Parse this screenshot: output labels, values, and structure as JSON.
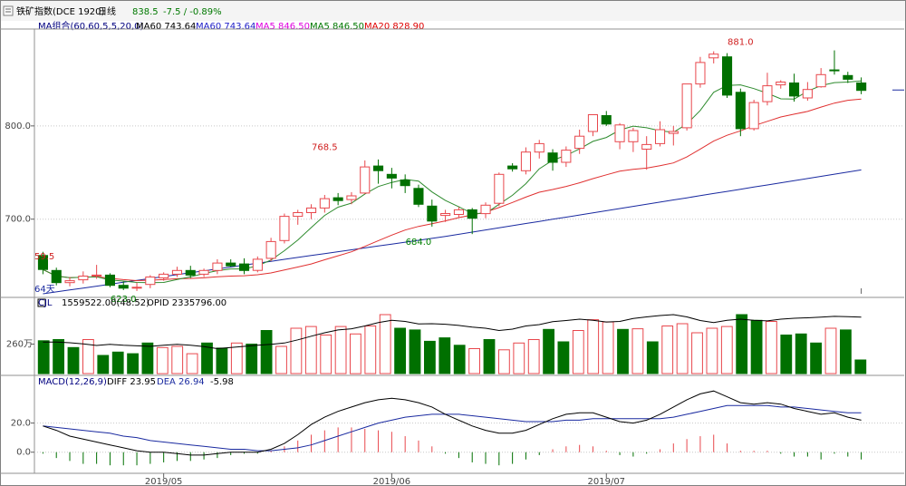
{
  "header": {
    "title": "铁矿指数(DCE 1920)",
    "period": "日线",
    "last": "838.5",
    "change": "-7.5 / -0.89%"
  },
  "ma_legend": [
    {
      "label": "MA组合(60,60,5,5,20,0)",
      "color": "#000080"
    },
    {
      "label": "MA60 743.64",
      "color": "#000000"
    },
    {
      "label": "MA60 743.64",
      "color": "#1e1ec8"
    },
    {
      "label": "MA5 846.50",
      "color": "#e000e0"
    },
    {
      "label": "MA5 846.50",
      "color": "#007800"
    },
    {
      "label": "MA20 828.90",
      "color": "#e00000"
    }
  ],
  "vol_legend": {
    "name": "CJL",
    "vol": "1559522.00(48:52)",
    "opi": "OPID 2335796.00"
  },
  "macd_legend": {
    "name": "MACD(12,26,9)",
    "diff": "DIFF 23.95",
    "dea": "DEA 26.94",
    "macd": "-5.98"
  },
  "colors": {
    "up": "#e8474c",
    "down": "#007000",
    "ma5": "#2e8b2e",
    "ma20": "#e03030",
    "ma60": "#1a2aa0",
    "grid": "#c8c8c8"
  },
  "chart_data": {
    "type": "candlestick",
    "price_ticks": [
      "800.0",
      "700.0"
    ],
    "volume_ticks": [
      "260万"
    ],
    "macd_ticks": [
      "20.0",
      "0.0"
    ],
    "date_labels": [
      {
        "label": "2019/05",
        "index": 9
      },
      {
        "label": "2019/06",
        "index": 26
      },
      {
        "label": "2019/07",
        "index": 42
      }
    ],
    "annotations": [
      {
        "text": "768.5",
        "index": 21,
        "price": 768.5,
        "pos": "above",
        "color": "#d02020"
      },
      {
        "text": "684.0",
        "index": 28,
        "price": 684.0,
        "pos": "below",
        "color": "#008000"
      },
      {
        "text": "881.0",
        "index": 52,
        "price": 881.0,
        "pos": "above",
        "color": "#d02020"
      },
      {
        "text": "623.0",
        "index": 6,
        "price": 623.0,
        "pos": "below",
        "color": "#008000"
      }
    ],
    "edge_labels": [
      {
        "text": "59.5",
        "color": "#d02020"
      },
      {
        "text": "64天",
        "color": "#1a2aa0"
      }
    ],
    "price_axis": {
      "min": 620,
      "max": 900
    },
    "candles": [
      [
        661,
        665,
        641,
        646
      ],
      [
        645,
        648,
        629,
        632
      ],
      [
        632,
        638,
        628,
        634
      ],
      [
        635,
        644,
        631,
        639
      ],
      [
        639,
        651,
        636,
        640
      ],
      [
        640,
        642,
        627,
        629
      ],
      [
        629,
        633,
        624,
        626
      ],
      [
        626,
        632,
        623,
        627
      ],
      [
        630,
        640,
        626,
        638
      ],
      [
        637,
        643,
        634,
        641
      ],
      [
        641,
        649,
        638,
        645
      ],
      [
        645,
        650,
        637,
        640
      ],
      [
        641,
        647,
        638,
        645
      ],
      [
        645,
        657,
        641,
        653
      ],
      [
        653,
        657,
        649,
        650
      ],
      [
        652,
        658,
        641,
        645
      ],
      [
        645,
        660,
        643,
        657
      ],
      [
        658,
        680,
        655,
        676
      ],
      [
        677,
        706,
        674,
        703
      ],
      [
        703,
        710,
        694,
        707
      ],
      [
        707,
        716,
        700,
        712
      ],
      [
        712,
        726,
        707,
        722
      ],
      [
        723,
        728,
        715,
        720
      ],
      [
        721,
        729,
        716,
        725
      ],
      [
        728,
        763,
        727,
        756
      ],
      [
        757,
        764,
        738,
        752
      ],
      [
        748,
        755,
        733,
        744
      ],
      [
        742,
        748,
        728,
        736
      ],
      [
        733,
        737,
        713,
        716
      ],
      [
        714,
        721,
        692,
        698
      ],
      [
        704,
        710,
        697,
        706
      ],
      [
        705,
        713,
        702,
        710
      ],
      [
        710,
        712,
        684,
        701
      ],
      [
        706,
        718,
        701,
        715
      ],
      [
        717,
        750,
        714,
        748
      ],
      [
        757,
        760,
        751,
        754
      ],
      [
        752,
        777,
        748,
        772
      ],
      [
        772,
        785,
        765,
        781
      ],
      [
        771,
        775,
        752,
        761
      ],
      [
        761,
        778,
        756,
        774
      ],
      [
        776,
        796,
        770,
        789
      ],
      [
        794,
        812,
        789,
        812
      ],
      [
        811,
        816,
        800,
        802
      ],
      [
        783,
        803,
        775,
        801
      ],
      [
        783,
        798,
        772,
        795
      ],
      [
        775,
        789,
        753,
        780
      ],
      [
        781,
        805,
        778,
        796
      ],
      [
        792,
        800,
        779,
        794
      ],
      [
        798,
        845,
        795,
        845
      ],
      [
        845,
        874,
        841,
        868
      ],
      [
        873,
        880,
        867,
        877
      ],
      [
        874,
        878,
        830,
        833
      ],
      [
        836,
        840,
        789,
        797
      ],
      [
        797,
        828,
        795,
        825
      ],
      [
        826,
        857,
        822,
        843
      ],
      [
        844,
        849,
        840,
        847
      ],
      [
        846,
        856,
        826,
        832
      ],
      [
        830,
        847,
        827,
        839
      ],
      [
        842,
        862,
        841,
        855
      ],
      [
        860,
        881,
        855,
        859
      ],
      [
        854,
        858,
        846,
        850
      ],
      [
        846,
        852,
        834,
        838
      ]
    ],
    "ma5": [
      null,
      null,
      null,
      null,
      null,
      null,
      null,
      null,
      null,
      null,
      null,
      null,
      null,
      null,
      null,
      null,
      null,
      null,
      null,
      null,
      null,
      null,
      null,
      null,
      null,
      null,
      null,
      null,
      null,
      null,
      null,
      null,
      null,
      null,
      null,
      null,
      null,
      null,
      null,
      null,
      null,
      null,
      null,
      null,
      null,
      null,
      null,
      null,
      null,
      null,
      null,
      null,
      null,
      null,
      null,
      null,
      null,
      null,
      null,
      null,
      null,
      null
    ],
    "volume": [
      {
        "v": 290,
        "up": false
      },
      {
        "v": 300,
        "up": false
      },
      {
        "v": 230,
        "up": false
      },
      {
        "v": 300,
        "up": true
      },
      {
        "v": 160,
        "up": false
      },
      {
        "v": 190,
        "up": false
      },
      {
        "v": 175,
        "up": false
      },
      {
        "v": 270,
        "up": false
      },
      {
        "v": 230,
        "up": true
      },
      {
        "v": 240,
        "up": true
      },
      {
        "v": 175,
        "up": true
      },
      {
        "v": 270,
        "up": false
      },
      {
        "v": 225,
        "up": false
      },
      {
        "v": 270,
        "up": true
      },
      {
        "v": 260,
        "up": false
      },
      {
        "v": 380,
        "up": false
      },
      {
        "v": 240,
        "up": true
      },
      {
        "v": 400,
        "up": true
      },
      {
        "v": 415,
        "up": true
      },
      {
        "v": 340,
        "up": true
      },
      {
        "v": 415,
        "up": true
      },
      {
        "v": 350,
        "up": true
      },
      {
        "v": 420,
        "up": true
      },
      {
        "v": 520,
        "up": true
      },
      {
        "v": 400,
        "up": false
      },
      {
        "v": 385,
        "up": false
      },
      {
        "v": 285,
        "up": false
      },
      {
        "v": 315,
        "up": false
      },
      {
        "v": 250,
        "up": false
      },
      {
        "v": 220,
        "up": true
      },
      {
        "v": 300,
        "up": false
      },
      {
        "v": 210,
        "up": true
      },
      {
        "v": 270,
        "up": true
      },
      {
        "v": 300,
        "up": true
      },
      {
        "v": 390,
        "up": false
      },
      {
        "v": 280,
        "up": false
      },
      {
        "v": 380,
        "up": true
      },
      {
        "v": 475,
        "up": true
      },
      {
        "v": 455,
        "up": true
      },
      {
        "v": 390,
        "up": false
      },
      {
        "v": 395,
        "up": true
      },
      {
        "v": 280,
        "up": false
      },
      {
        "v": 420,
        "up": true
      },
      {
        "v": 440,
        "up": true
      },
      {
        "v": 360,
        "up": true
      },
      {
        "v": 400,
        "up": true
      },
      {
        "v": 415,
        "up": true
      },
      {
        "v": 520,
        "up": false
      },
      {
        "v": 470,
        "up": false
      },
      {
        "v": 460,
        "up": true
      },
      {
        "v": 340,
        "up": false
      },
      {
        "v": 350,
        "up": false
      },
      {
        "v": 270,
        "up": false
      },
      {
        "v": 400,
        "up": true
      },
      {
        "v": 385,
        "up": false
      },
      {
        "v": 120,
        "up": false
      }
    ],
    "oi": [
      278,
      278,
      272,
      262,
      248,
      258,
      250,
      245,
      240,
      250,
      258,
      250,
      238,
      220,
      230,
      240,
      250,
      258,
      270,
      298,
      330,
      360,
      385,
      395,
      420,
      450,
      470,
      460,
      438,
      440,
      435,
      425,
      410,
      400,
      380,
      392,
      420,
      432,
      458,
      468,
      480,
      470,
      455,
      460,
      486,
      500,
      512,
      520,
      500,
      468,
      450,
      470,
      480,
      470,
      465,
      480,
      488,
      492,
      498,
      505,
      502,
      498
    ],
    "volume_axis": {
      "max": 560
    },
    "macd": {
      "diff": [
        18,
        15,
        11,
        9,
        7,
        5,
        3,
        1,
        0,
        0,
        -1,
        -2,
        -2,
        -1,
        0,
        0,
        0,
        2,
        6,
        12,
        19,
        24,
        28,
        31,
        34,
        36,
        37,
        36,
        34,
        31,
        26,
        22,
        18,
        15,
        13,
        13,
        15,
        19,
        23,
        26,
        27,
        27,
        24,
        21,
        20,
        22,
        26,
        31,
        36,
        40,
        42,
        38,
        34,
        33,
        34,
        33,
        30,
        28,
        26,
        27,
        24,
        22
      ],
      "dea": [
        18,
        17,
        16,
        15,
        14,
        13,
        11,
        10,
        8,
        7,
        6,
        5,
        4,
        3,
        2,
        2,
        1,
        1,
        2,
        3,
        5,
        8,
        11,
        14,
        17,
        20,
        22,
        24,
        25,
        26,
        26,
        26,
        25,
        24,
        23,
        22,
        21,
        21,
        21,
        22,
        22,
        23,
        23,
        23,
        23,
        23,
        23,
        24,
        26,
        28,
        30,
        32,
        32,
        32,
        32,
        31,
        31,
        30,
        29,
        28,
        27,
        27
      ],
      "hist": [
        -1,
        -4,
        -6,
        -8,
        -8,
        -9,
        -9,
        -9,
        -8,
        -7,
        -6,
        -6,
        -5,
        -4,
        -2,
        -1,
        -1,
        1,
        4,
        8,
        12,
        15,
        17,
        17,
        16,
        15,
        14,
        11,
        8,
        4,
        -1,
        -4,
        -7,
        -8,
        -9,
        -8,
        -5,
        -2,
        2,
        4,
        5,
        4,
        1,
        -2,
        -3,
        -1,
        2,
        6,
        9,
        11,
        12,
        6,
        1,
        1,
        1,
        -1,
        -3,
        -3,
        -5,
        -1,
        -3,
        -5
      ],
      "axis": {
        "min": -12,
        "max": 44
      }
    }
  }
}
